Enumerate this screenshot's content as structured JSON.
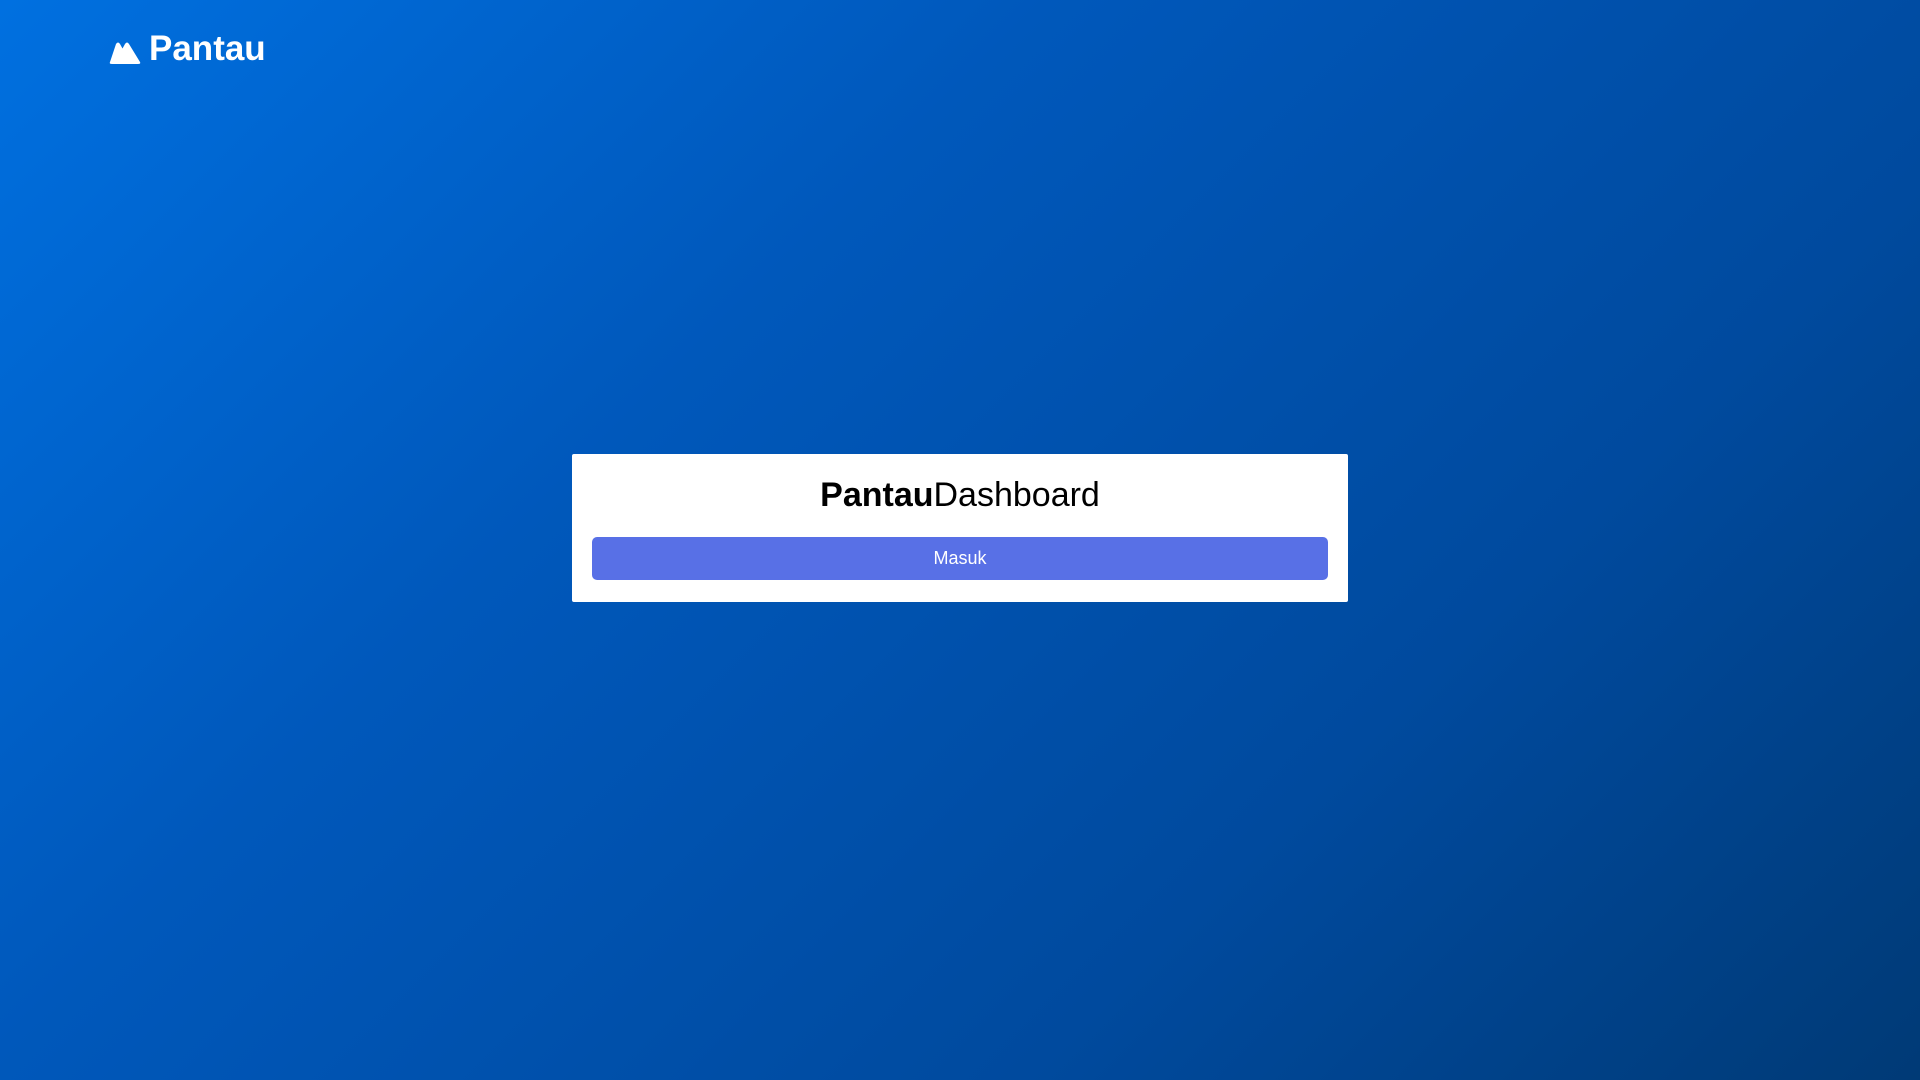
{
  "header": {
    "brand_name": "Pantau",
    "brand_icon": "mountain-icon"
  },
  "login_card": {
    "title_bold": "Pantau",
    "title_light": "Dashboard",
    "button_label": "Masuk"
  },
  "colors": {
    "background_gradient_start": "#0070e0",
    "background_gradient_end": "#003a76",
    "card_background": "#ffffff",
    "button_background": "#5870e6",
    "button_text": "#ffffff"
  }
}
